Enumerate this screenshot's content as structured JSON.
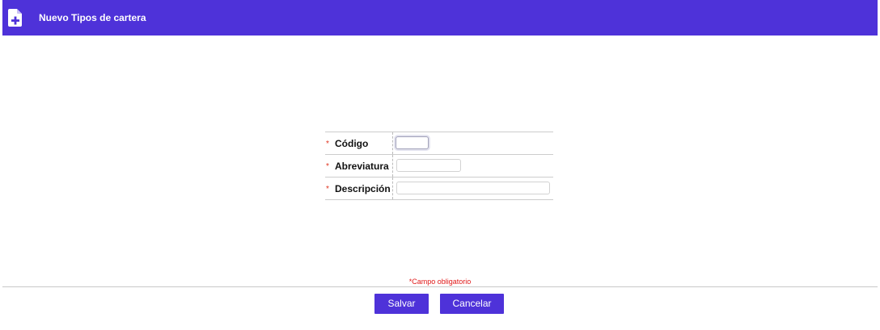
{
  "header": {
    "title": "Nuevo Tipos de cartera",
    "icon": "file-plus-icon",
    "background_color": "#4e32d9"
  },
  "form": {
    "required_marker": "*",
    "fields": [
      {
        "label": "Código",
        "value": "",
        "placeholder": ""
      },
      {
        "label": "Abreviatura",
        "value": "",
        "placeholder": ""
      },
      {
        "label": "Descripción",
        "value": "",
        "placeholder": ""
      }
    ]
  },
  "footer": {
    "required_note": "*Campo obligatorio",
    "save_label": "Salvar",
    "cancel_label": "Cancelar"
  }
}
